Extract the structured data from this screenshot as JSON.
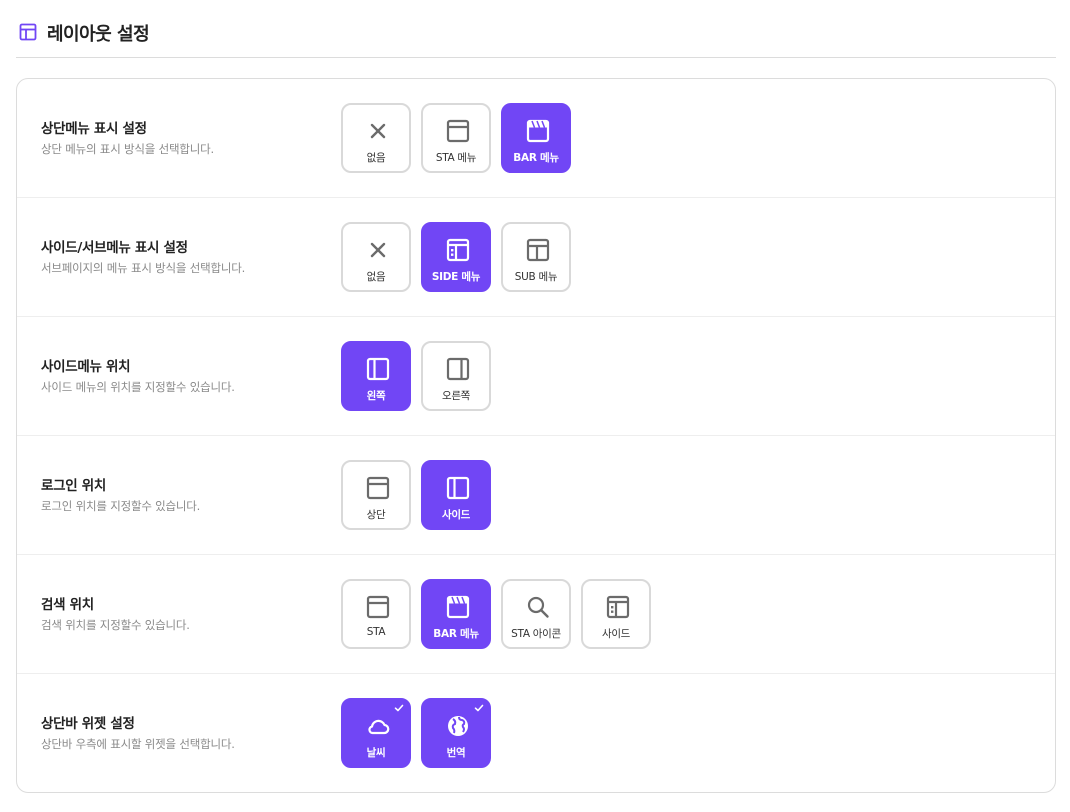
{
  "header": {
    "title": "레이아웃 설정",
    "icon": "layout-icon",
    "accent": "#7146f5"
  },
  "colors": {
    "accent": "#7146f5",
    "border": "#d9d9d9",
    "muted": "#8a8a8a"
  },
  "rows": [
    {
      "title": "상단메뉴 표시 설정",
      "desc": "상단 메뉴의 표시 방식을 선택합니다.",
      "options": [
        {
          "label": "없음",
          "icon": "close-icon",
          "selected": false
        },
        {
          "label": "STA 메뉴",
          "icon": "top-bar-layout-icon",
          "selected": false
        },
        {
          "label": "BAR 메뉴",
          "icon": "striped-bar-icon",
          "selected": true
        }
      ]
    },
    {
      "title": "사이드/서브메뉴 표시 설정",
      "desc": "서브페이지의 메뉴 표시 방식을 선택합니다.",
      "options": [
        {
          "label": "없음",
          "icon": "close-icon",
          "selected": false
        },
        {
          "label": "SIDE 메뉴",
          "icon": "side-menu-layout-icon",
          "selected": true
        },
        {
          "label": "SUB 메뉴",
          "icon": "sub-menu-layout-icon",
          "selected": false
        }
      ]
    },
    {
      "title": "사이드메뉴 위치",
      "desc": "사이드 메뉴의 위치를 지정할수 있습니다.",
      "options": [
        {
          "label": "왼쪽",
          "icon": "left-panel-icon",
          "selected": true
        },
        {
          "label": "오른쪽",
          "icon": "right-panel-icon",
          "selected": false
        }
      ]
    },
    {
      "title": "로그인 위치",
      "desc": "로그인 위치를 지정할수 있습니다.",
      "options": [
        {
          "label": "상단",
          "icon": "top-bar-layout-icon",
          "selected": false
        },
        {
          "label": "사이드",
          "icon": "left-panel-icon",
          "selected": true
        }
      ]
    },
    {
      "title": "검색 위치",
      "desc": "검색 위치를 지정할수 있습니다.",
      "options": [
        {
          "label": "STA",
          "icon": "top-bar-layout-icon",
          "selected": false
        },
        {
          "label": "BAR 메뉴",
          "icon": "striped-bar-icon",
          "selected": true
        },
        {
          "label": "STA 아이콘",
          "icon": "search-icon",
          "selected": false
        },
        {
          "label": "사이드",
          "icon": "side-menu-layout-icon",
          "selected": false
        }
      ]
    },
    {
      "title": "상단바 위젯 설정",
      "desc": "상단바 우측에 표시할 위젯을 선택합니다.",
      "options": [
        {
          "label": "날씨",
          "icon": "cloud-icon",
          "selected": true,
          "checked": true
        },
        {
          "label": "번역",
          "icon": "globe-icon",
          "selected": true,
          "checked": true
        }
      ]
    }
  ]
}
